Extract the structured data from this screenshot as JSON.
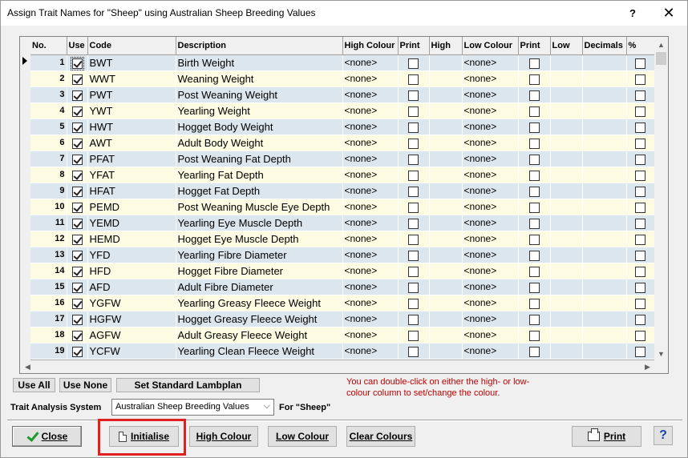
{
  "window": {
    "title": "Assign Trait Names for \"Sheep\" using Australian Sheep Breeding Values",
    "help_glyph": "?",
    "close_glyph": "✕"
  },
  "grid": {
    "headers": [
      "No.",
      "Use",
      "Code",
      "Description",
      "High Colour",
      "Print",
      "High",
      "Low Colour",
      "Print",
      "Low",
      "Decimals",
      "%"
    ],
    "rows": [
      {
        "no": "1",
        "use": true,
        "code": "BWT",
        "desc": "Birth Weight",
        "high_colour": "<none>",
        "low_colour": "<none>"
      },
      {
        "no": "2",
        "use": true,
        "code": "WWT",
        "desc": "Weaning Weight",
        "high_colour": "<none>",
        "low_colour": "<none>"
      },
      {
        "no": "3",
        "use": true,
        "code": "PWT",
        "desc": "Post Weaning Weight",
        "high_colour": "<none>",
        "low_colour": "<none>"
      },
      {
        "no": "4",
        "use": true,
        "code": "YWT",
        "desc": "Yearling Weight",
        "high_colour": "<none>",
        "low_colour": "<none>"
      },
      {
        "no": "5",
        "use": true,
        "code": "HWT",
        "desc": "Hogget Body Weight",
        "high_colour": "<none>",
        "low_colour": "<none>"
      },
      {
        "no": "6",
        "use": true,
        "code": "AWT",
        "desc": "Adult Body Weight",
        "high_colour": "<none>",
        "low_colour": "<none>"
      },
      {
        "no": "7",
        "use": true,
        "code": "PFAT",
        "desc": "Post Weaning Fat Depth",
        "high_colour": "<none>",
        "low_colour": "<none>"
      },
      {
        "no": "8",
        "use": true,
        "code": "YFAT",
        "desc": "Yearling Fat Depth",
        "high_colour": "<none>",
        "low_colour": "<none>"
      },
      {
        "no": "9",
        "use": true,
        "code": "HFAT",
        "desc": "Hogget Fat Depth",
        "high_colour": "<none>",
        "low_colour": "<none>"
      },
      {
        "no": "10",
        "use": true,
        "code": "PEMD",
        "desc": "Post Weaning Muscle Eye Depth",
        "high_colour": "<none>",
        "low_colour": "<none>"
      },
      {
        "no": "11",
        "use": true,
        "code": "YEMD",
        "desc": "Yearling Eye Muscle Depth",
        "high_colour": "<none>",
        "low_colour": "<none>"
      },
      {
        "no": "12",
        "use": true,
        "code": "HEMD",
        "desc": "Hogget Eye Muscle Depth",
        "high_colour": "<none>",
        "low_colour": "<none>"
      },
      {
        "no": "13",
        "use": true,
        "code": "YFD",
        "desc": "Yearling Fibre Diameter",
        "high_colour": "<none>",
        "low_colour": "<none>"
      },
      {
        "no": "14",
        "use": true,
        "code": "HFD",
        "desc": "Hogget Fibre Diameter",
        "high_colour": "<none>",
        "low_colour": "<none>"
      },
      {
        "no": "15",
        "use": true,
        "code": "AFD",
        "desc": "Adult Fibre Diameter",
        "high_colour": "<none>",
        "low_colour": "<none>"
      },
      {
        "no": "16",
        "use": true,
        "code": "YGFW",
        "desc": "Yearling Greasy Fleece Weight",
        "high_colour": "<none>",
        "low_colour": "<none>"
      },
      {
        "no": "17",
        "use": true,
        "code": "HGFW",
        "desc": "Hogget Greasy Fleece Weight",
        "high_colour": "<none>",
        "low_colour": "<none>"
      },
      {
        "no": "18",
        "use": true,
        "code": "AGFW",
        "desc": "Adult Greasy Fleece Weight",
        "high_colour": "<none>",
        "low_colour": "<none>"
      },
      {
        "no": "19",
        "use": true,
        "code": "YCFW",
        "desc": "Yearling Clean Fleece Weight",
        "high_colour": "<none>",
        "low_colour": "<none>"
      }
    ]
  },
  "toolbar": {
    "use_all": "Use All",
    "use_none": "Use None",
    "set_standard": "Set Standard Lambplan",
    "hint": "You can double-click on either the high- or low-colour column to set/change the colour.",
    "trait_system_label": "Trait Analysis System",
    "trait_system_value": "Australian Sheep Breeding Values",
    "for_label": "For \"Sheep\""
  },
  "buttons": {
    "close": "Close",
    "initialise": "Initialise",
    "high_colour": "High Colour",
    "low_colour": "Low Colour",
    "clear_colours": "Clear Colours",
    "print": "Print",
    "help": "?"
  },
  "colors": {
    "row_even": "#dce6ee",
    "row_odd": "#fdfbe1",
    "hint_text": "#c00000",
    "highlight_box": "#e0201e",
    "close_check": "#1e9a2a"
  }
}
